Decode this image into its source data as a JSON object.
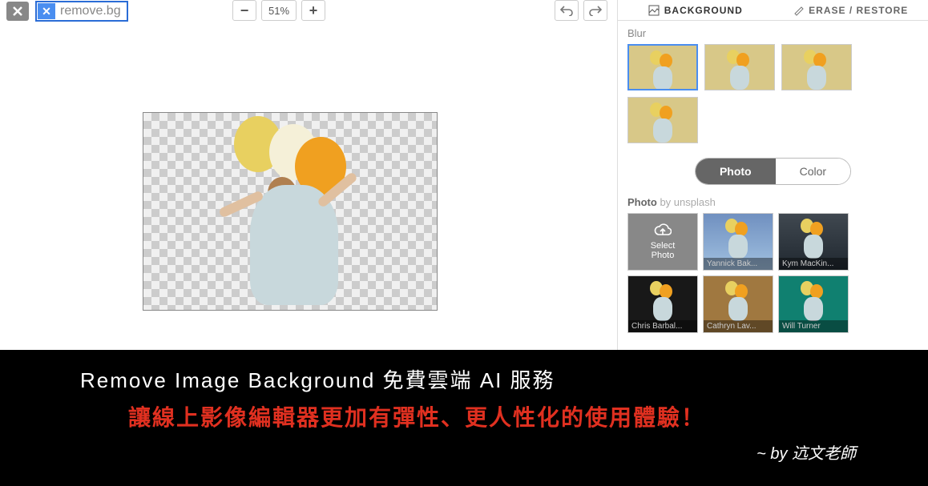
{
  "header": {
    "logo_text": "remove.bg",
    "zoom_value": "51%"
  },
  "tabs": {
    "background": "BACKGROUND",
    "erase_restore": "ERASE / RESTORE"
  },
  "sections": {
    "blur_label": "Blur",
    "photo_label": "Photo",
    "photo_by": "by unsplash"
  },
  "toggle": {
    "photo": "Photo",
    "color": "Color"
  },
  "upload": {
    "line1": "Select",
    "line2": "Photo"
  },
  "photo_credits": [
    "Yannick Bak...",
    "Kym MacKin...",
    "Chris Barbal...",
    "Cathryn Lav...",
    "Will Turner"
  ],
  "overlay": {
    "line1": "Remove Image Background 免費雲端 AI 服務",
    "line2": "讓線上影像編輯器更加有彈性、更人性化的使用體驗！",
    "byline": "~ by 迒文老師"
  }
}
